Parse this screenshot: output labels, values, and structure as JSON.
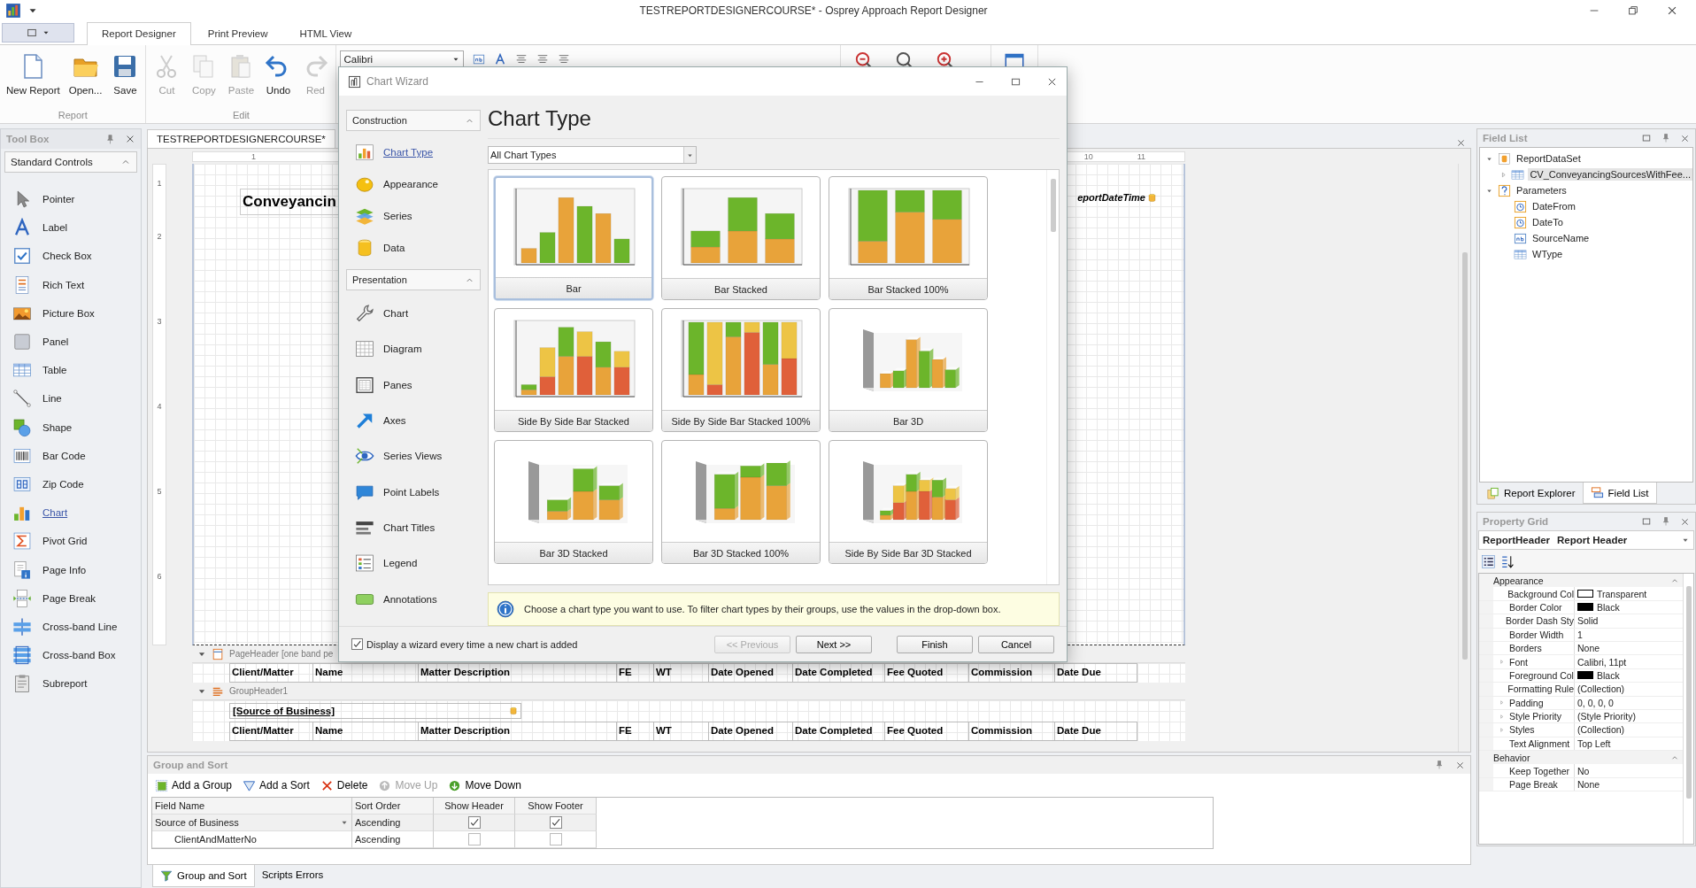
{
  "window": {
    "title": "TESTREPORTDESIGNERCOURSE* - Osprey Approach Report Designer"
  },
  "ribbon": {
    "tabs": [
      {
        "label": "Report Designer",
        "selected": true
      },
      {
        "label": "Print Preview",
        "selected": false
      },
      {
        "label": "HTML View",
        "selected": false
      }
    ],
    "groups": [
      {
        "label": "Report",
        "buttons": [
          {
            "label": "New Report",
            "disabled": false
          },
          {
            "label": "Open...",
            "disabled": false
          },
          {
            "label": "Save",
            "disabled": false
          }
        ]
      },
      {
        "label": "Edit",
        "buttons": [
          {
            "label": "Cut",
            "disabled": true
          },
          {
            "label": "Copy",
            "disabled": true
          },
          {
            "label": "Paste",
            "disabled": true
          },
          {
            "label": "Undo",
            "disabled": false
          },
          {
            "label": "Red",
            "disabled": true
          }
        ]
      }
    ],
    "font_box": {
      "value": "Calibri"
    }
  },
  "toolbox": {
    "title": "Tool Box",
    "section": "Standard Controls",
    "items": [
      {
        "label": "Pointer",
        "selected": false
      },
      {
        "label": "Label",
        "selected": false
      },
      {
        "label": "Check Box",
        "selected": false
      },
      {
        "label": "Rich Text",
        "selected": false
      },
      {
        "label": "Picture Box",
        "selected": false
      },
      {
        "label": "Panel",
        "selected": false
      },
      {
        "label": "Table",
        "selected": false
      },
      {
        "label": "Line",
        "selected": false
      },
      {
        "label": "Shape",
        "selected": false
      },
      {
        "label": "Bar Code",
        "selected": false
      },
      {
        "label": "Zip Code",
        "selected": false
      },
      {
        "label": "Chart",
        "selected": true
      },
      {
        "label": "Pivot Grid",
        "selected": false
      },
      {
        "label": "Page Info",
        "selected": false
      },
      {
        "label": "Page Break",
        "selected": false
      },
      {
        "label": "Cross-band Line",
        "selected": false
      },
      {
        "label": "Cross-band Box",
        "selected": false
      },
      {
        "label": "Subreport",
        "selected": false
      }
    ]
  },
  "designer": {
    "tab": "TESTREPORTDESIGNERCOURSE*",
    "top_ruler": [
      "1",
      "10",
      "11"
    ],
    "side_ruler": [
      "1",
      "2",
      "3",
      "4",
      "5",
      "6"
    ],
    "title_label": "Conveyancin",
    "date_label": "eportDateTime",
    "bands": [
      {
        "kind": "band",
        "label": "PageHeader [one band pe"
      },
      {
        "kind": "columns",
        "cells": [
          "Client/Matter",
          "Name",
          "Matter Description",
          "FE",
          "WT",
          "Date Opened",
          "Date Completed",
          "Fee Quoted",
          "Commission",
          "Date Due"
        ]
      },
      {
        "kind": "band",
        "label": "GroupHeader1"
      },
      {
        "kind": "field",
        "label": "[Source of Business]"
      },
      {
        "kind": "columns",
        "cells": [
          "Client/Matter",
          "Name",
          "Matter Description",
          "FE",
          "WT",
          "Date Opened",
          "Date Completed",
          "Fee Quoted",
          "Commission",
          "Date Due"
        ]
      }
    ]
  },
  "group_sort": {
    "title": "Group and Sort",
    "toolbar": [
      {
        "label": "Add a Group",
        "disabled": false
      },
      {
        "label": "Add a Sort",
        "disabled": false
      },
      {
        "label": "Delete",
        "disabled": false
      },
      {
        "label": "Move Up",
        "disabled": true
      },
      {
        "label": "Move Down",
        "disabled": false
      }
    ],
    "columns": [
      "Field Name",
      "Sort Order",
      "Show Header",
      "Show Footer"
    ],
    "rows": [
      {
        "field": "Source of Business",
        "sort": "Ascending",
        "show_header": true,
        "show_footer": true,
        "selected": true,
        "children": [
          {
            "field": "ClientAndMatterNo",
            "sort": "Ascending",
            "show_header": false,
            "show_footer": false,
            "selected": false
          }
        ]
      }
    ]
  },
  "bottom_tabs": [
    {
      "label": "Group and Sort",
      "selected": true
    },
    {
      "label": "Scripts Errors",
      "selected": false
    }
  ],
  "field_list": {
    "title": "Field List",
    "tree": [
      {
        "label": "ReportDataSet",
        "kind": "dataset",
        "expanded": true,
        "selected": false,
        "children": [
          {
            "label": "CV_ConveyancingSourcesWithFee...",
            "kind": "table",
            "expanded": false,
            "selected": true
          }
        ]
      },
      {
        "label": "Parameters",
        "kind": "parameters",
        "expanded": true,
        "selected": false,
        "children": [
          {
            "label": "DateFrom",
            "kind": "date",
            "selected": false
          },
          {
            "label": "DateTo",
            "kind": "date",
            "selected": false
          },
          {
            "label": "SourceName",
            "kind": "text",
            "selected": false
          },
          {
            "label": "WType",
            "kind": "table",
            "selected": false
          }
        ]
      }
    ],
    "tabs": [
      {
        "label": "Report Explorer",
        "selected": false
      },
      {
        "label": "Field List",
        "selected": true
      }
    ]
  },
  "property_grid": {
    "title": "Property Grid",
    "object_name": "ReportHeader",
    "object_type": "Report Header",
    "categories": [
      {
        "label": "Appearance",
        "expanded": true,
        "rows": [
          {
            "name": "Background Col",
            "value": "Transparent",
            "color": "#ffffff",
            "expandable": false
          },
          {
            "name": "Border Color",
            "value": "Black",
            "color": "#000000",
            "expandable": false
          },
          {
            "name": "Border Dash Sty",
            "value": "Solid",
            "expandable": false
          },
          {
            "name": "Border Width",
            "value": "1",
            "expandable": false
          },
          {
            "name": "Borders",
            "value": "None",
            "expandable": false
          },
          {
            "name": "Font",
            "value": "Calibri, 11pt",
            "expandable": true
          },
          {
            "name": "Foreground Col",
            "value": "Black",
            "color": "#000000",
            "expandable": false
          },
          {
            "name": "Formatting Rule",
            "value": "(Collection)",
            "expandable": false
          },
          {
            "name": "Padding",
            "value": "0, 0, 0, 0",
            "expandable": true
          },
          {
            "name": "Style Priority",
            "value": "(Style Priority)",
            "expandable": true
          },
          {
            "name": "Styles",
            "value": "(Collection)",
            "expandable": true
          },
          {
            "name": "Text Alignment",
            "value": "Top Left",
            "expandable": false
          }
        ]
      },
      {
        "label": "Behavior",
        "expanded": true,
        "rows": [
          {
            "name": "Keep Together",
            "value": "No",
            "expandable": false
          },
          {
            "name": "Page Break",
            "value": "None",
            "expandable": false
          }
        ]
      }
    ]
  },
  "wizard": {
    "title": "Chart Wizard",
    "nav": [
      {
        "label": "Construction",
        "expanded": true,
        "items": [
          {
            "label": "Chart Type",
            "selected": true
          },
          {
            "label": "Appearance",
            "selected": false
          },
          {
            "label": "Series",
            "selected": false
          },
          {
            "label": "Data",
            "selected": false
          }
        ]
      },
      {
        "label": "Presentation",
        "expanded": true,
        "items": [
          {
            "label": "Chart",
            "selected": false
          },
          {
            "label": "Diagram",
            "selected": false
          },
          {
            "label": "Panes",
            "selected": false
          },
          {
            "label": "Axes",
            "selected": false
          },
          {
            "label": "Series Views",
            "selected": false
          },
          {
            "label": "Point Labels",
            "selected": false
          },
          {
            "label": "Chart Titles",
            "selected": false
          },
          {
            "label": "Legend",
            "selected": false
          },
          {
            "label": "Annotations",
            "selected": false
          }
        ]
      }
    ],
    "heading": "Chart Type",
    "filter": {
      "value": "All Chart Types"
    },
    "tiles": [
      {
        "label": "Bar",
        "kind": "bar",
        "selected": true
      },
      {
        "label": "Bar Stacked",
        "kind": "stacked",
        "selected": false
      },
      {
        "label": "Bar Stacked 100%",
        "kind": "stacked100",
        "selected": false
      },
      {
        "label": "Side By Side Bar Stacked",
        "kind": "sbs_stacked",
        "selected": false
      },
      {
        "label": "Side By Side Bar Stacked 100%",
        "kind": "sbs_stacked100",
        "selected": false
      },
      {
        "label": "Bar 3D",
        "kind": "bar3d",
        "selected": false
      },
      {
        "label": "Bar 3D Stacked",
        "kind": "bar3d_stacked",
        "selected": false
      },
      {
        "label": "Bar 3D Stacked 100%",
        "kind": "bar3d_stacked100",
        "selected": false
      },
      {
        "label": "Side By Side Bar 3D Stacked",
        "kind": "sbs_3d_stacked",
        "selected": false
      }
    ],
    "hint": "Choose a chart type you want to use. To filter chart types by their groups, use the values in the drop-down box.",
    "show_wizard": {
      "label": "Display a wizard every time a new chart is added",
      "checked": true
    },
    "buttons": [
      {
        "label": "<< Previous",
        "disabled": true
      },
      {
        "label": "Next >>",
        "disabled": false
      },
      {
        "label": "Finish",
        "disabled": false
      },
      {
        "label": "Cancel",
        "disabled": false
      }
    ]
  }
}
